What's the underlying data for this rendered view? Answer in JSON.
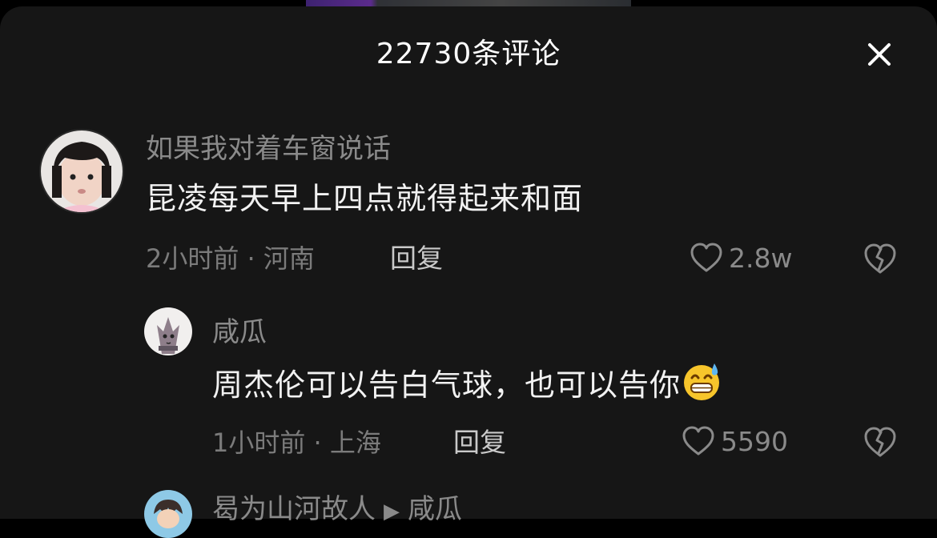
{
  "header": {
    "title": "22730条评论",
    "close_icon": "close-icon"
  },
  "comments": [
    {
      "user": "如果我对着车窗说话",
      "text": "昆凌每天早上四点就得起来和面",
      "meta": "2小时前 · 河南",
      "reply_label": "回复",
      "likes": "2.8w",
      "avatar": "child-avatar"
    }
  ],
  "replies": [
    {
      "user": "咸瓜",
      "text": "周杰伦可以告白气球，也可以告你",
      "emoji": "grinning-sweat-emoji",
      "meta": "1小时前 · 上海",
      "reply_label": "回复",
      "likes": "5590",
      "avatar": "cat-avatar"
    },
    {
      "user": "曷为山河故人",
      "reply_to": "咸瓜",
      "avatar": "cartoon-avatar"
    }
  ],
  "icons": {
    "like": "heart-outline-icon",
    "dislike": "broken-heart-icon",
    "arrow": "play-arrow-icon"
  },
  "colors": {
    "background": "#161616",
    "username": "#8a8a8a",
    "content": "#f2f2f2",
    "meta": "#7b7b7b"
  }
}
